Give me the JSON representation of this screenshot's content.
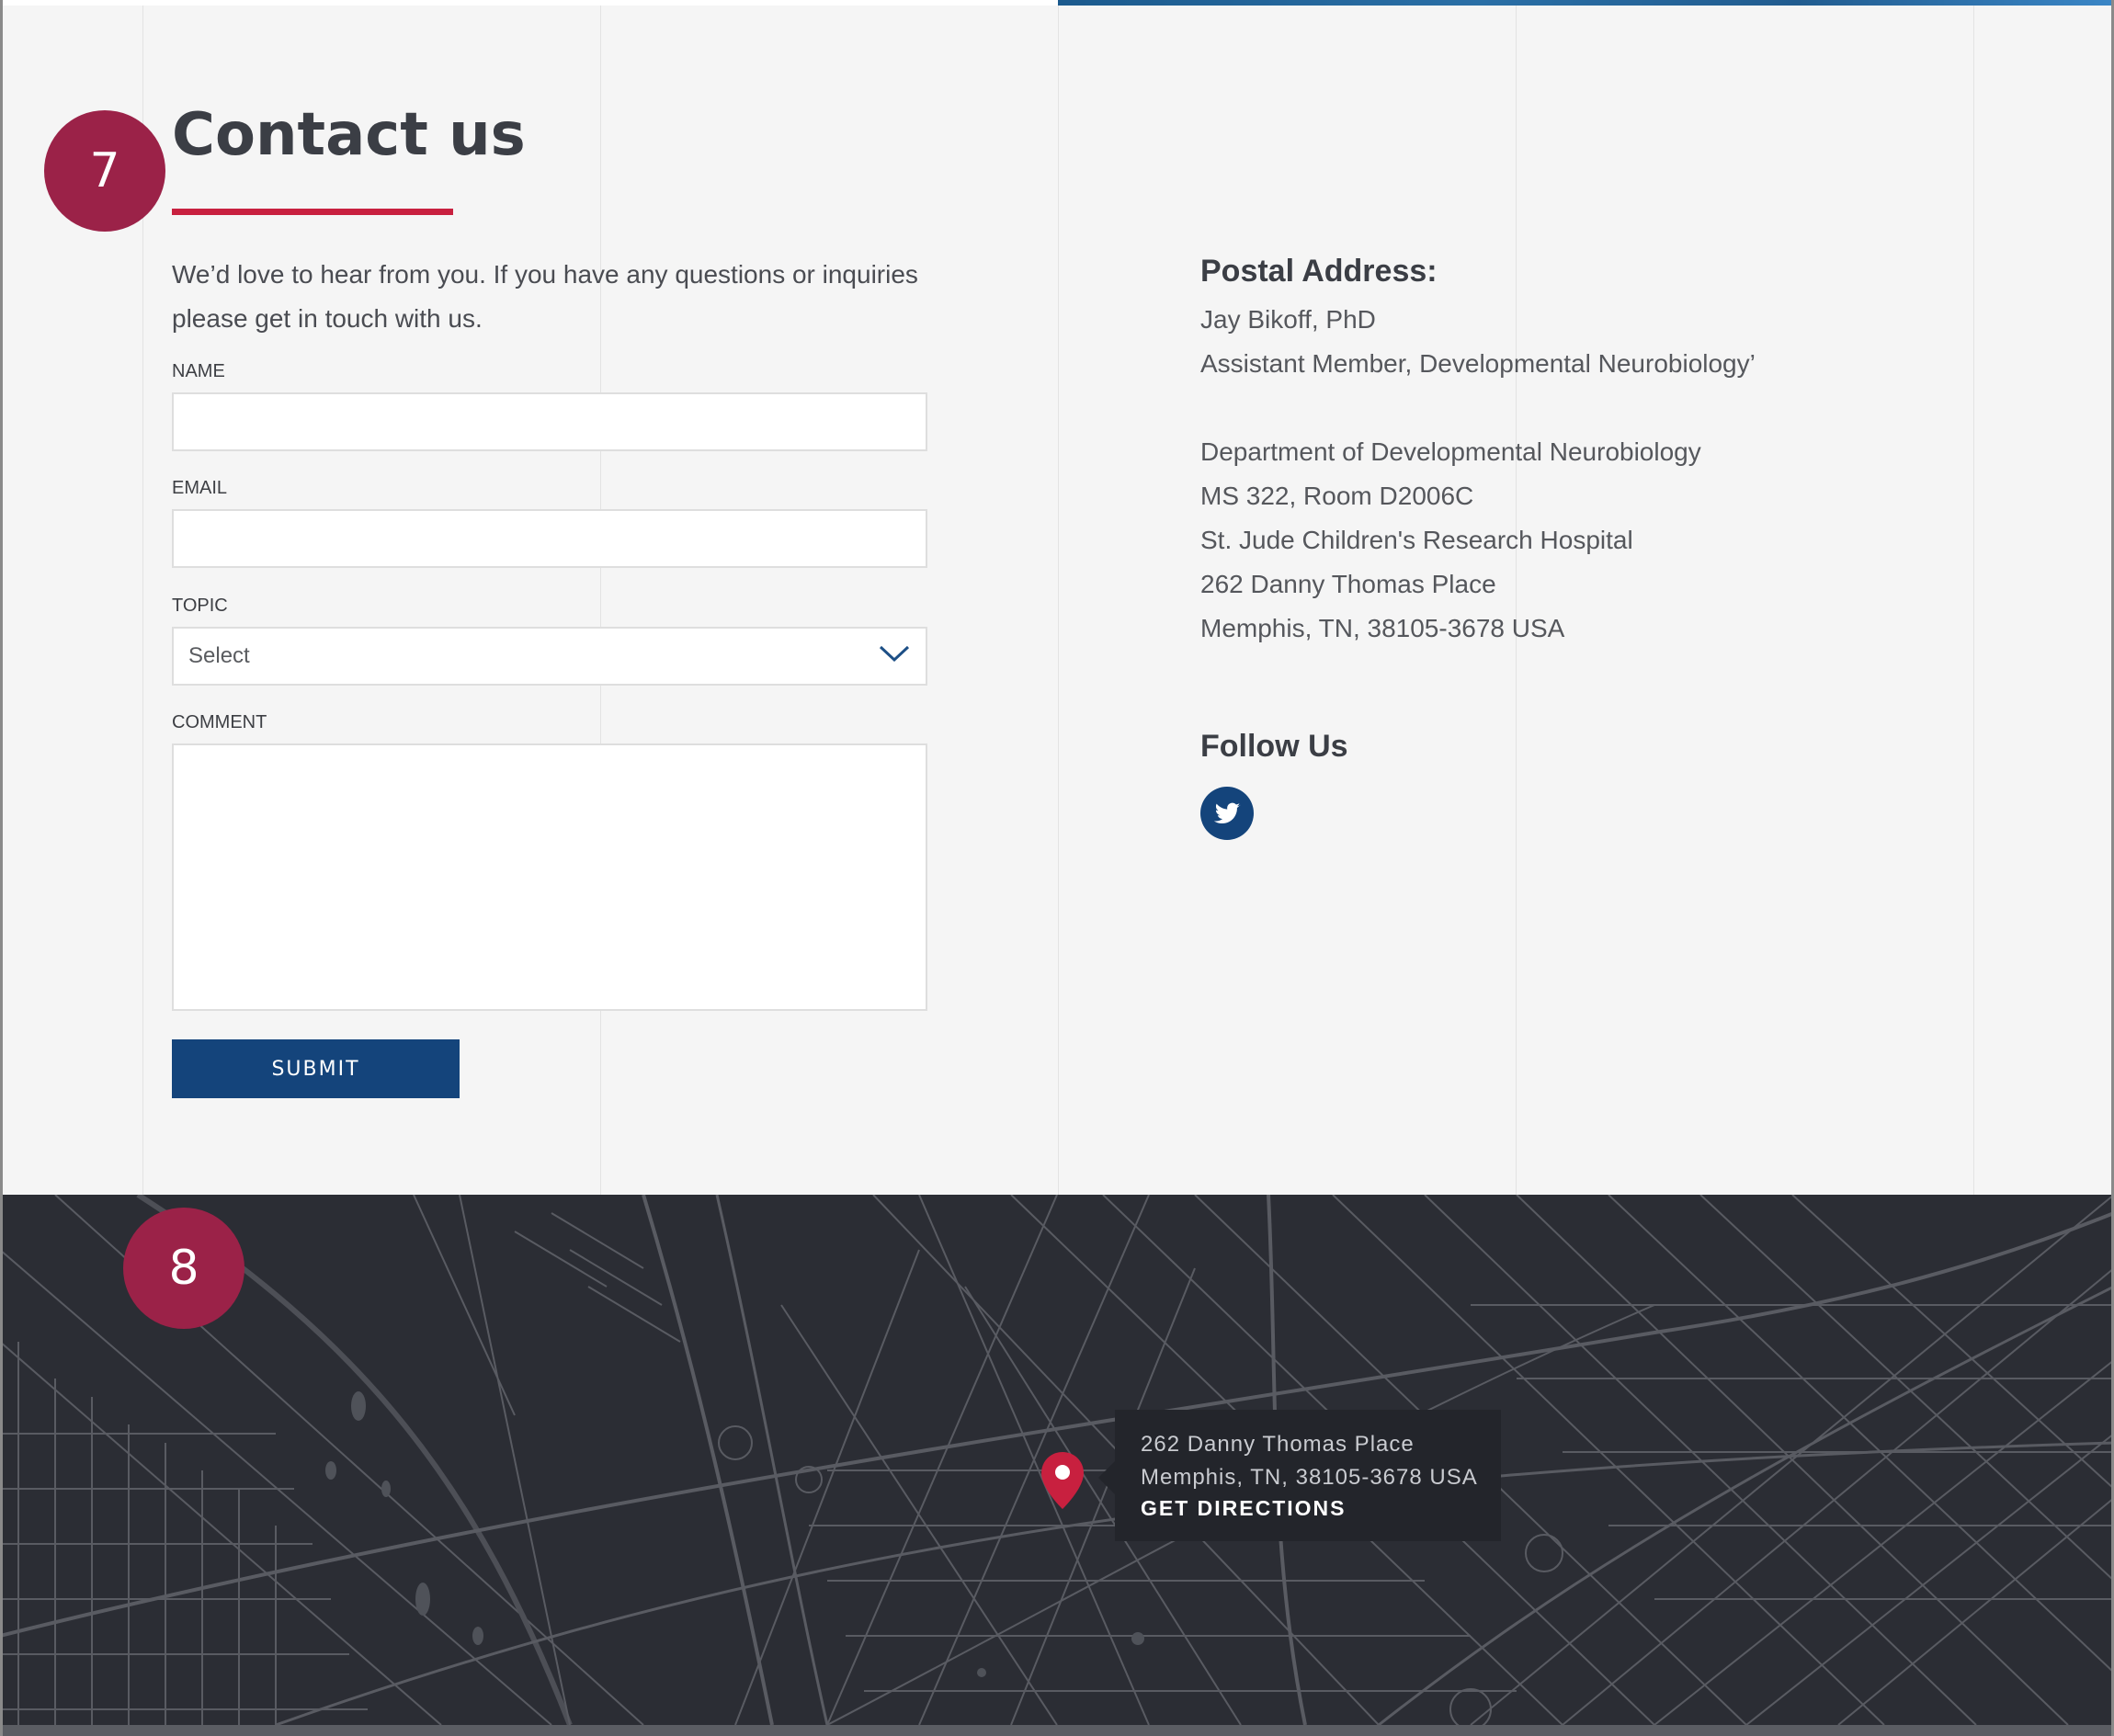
{
  "badges": {
    "contact": "7",
    "map": "8"
  },
  "contact": {
    "title": "Contact us",
    "intro": "We’d love to hear from you. If you have any questions or inquiries please get in touch with us.",
    "form": {
      "name_label": "NAME",
      "email_label": "EMAIL",
      "topic_label": "TOPIC",
      "topic_selected": "Select",
      "comment_label": "COMMENT",
      "submit_label": "SUBMIT"
    }
  },
  "postal": {
    "title": "Postal Address:",
    "lines": [
      "Jay Bikoff, PhD",
      "Assistant Member, Developmental Neurobiology’",
      "",
      "Department of Developmental Neurobiology",
      "MS 322, Room D2006C",
      "St. Jude Children's Research Hospital",
      "262 Danny Thomas Place",
      "Memphis, TN, 38105-3678 USA"
    ]
  },
  "follow": {
    "title": "Follow Us",
    "icon": "twitter-icon"
  },
  "map": {
    "address_line1": "262 Danny Thomas Place",
    "address_line2": "Memphis, TN, 38105-3678 USA",
    "directions_label": "GET DIRECTIONS",
    "pin_icon": "map-pin-icon"
  },
  "colors": {
    "accent_red": "#c8203f",
    "badge": "#9b2248",
    "primary_blue": "#14447b",
    "map_bg": "#2b2d34",
    "page_bg": "#f5f5f5"
  }
}
